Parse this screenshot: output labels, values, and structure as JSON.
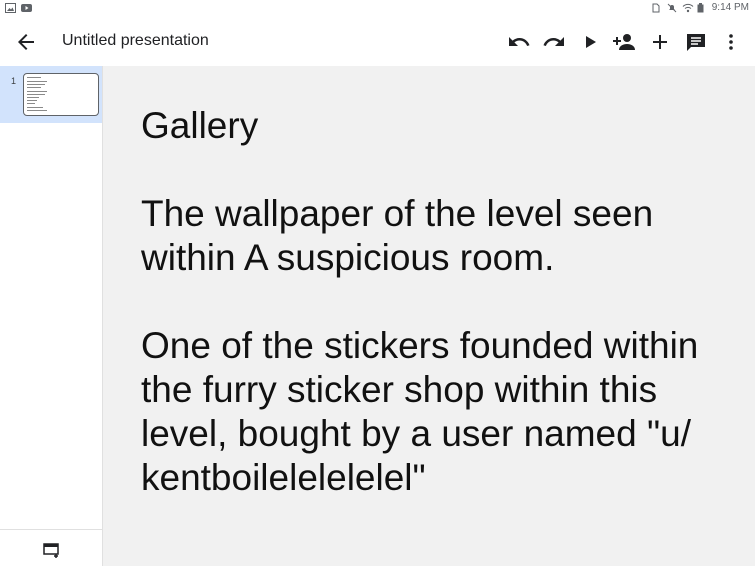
{
  "status_bar": {
    "left_icons": [
      "gallery-icon",
      "youtube-icon"
    ],
    "right_icons": [
      "sim-icon",
      "no-notifications-icon",
      "wifi-icon",
      "battery-icon"
    ],
    "time": "9:14 PM"
  },
  "app_bar": {
    "title": "Untitled presentation",
    "actions": [
      "undo-icon",
      "redo-icon",
      "play-icon",
      "add-person-icon",
      "add-icon",
      "comment-icon",
      "more-vert-icon"
    ]
  },
  "slides_panel": {
    "slides": [
      {
        "number": "1",
        "selected": true
      }
    ],
    "new_slide_icon": "add-slide-icon"
  },
  "slide": {
    "paragraphs": [
      "Gallery",
      "The wallpaper of the level seen within A suspicious room.",
      "One of the stickers founded within the furry sticker shop within this level, bought by a user named \"u/ kentboilelelelelel\""
    ]
  },
  "colors": {
    "selected_thumb_bg": "#d2e3fc",
    "canvas_bg": "#f1f1f1",
    "icon": "#202124"
  }
}
